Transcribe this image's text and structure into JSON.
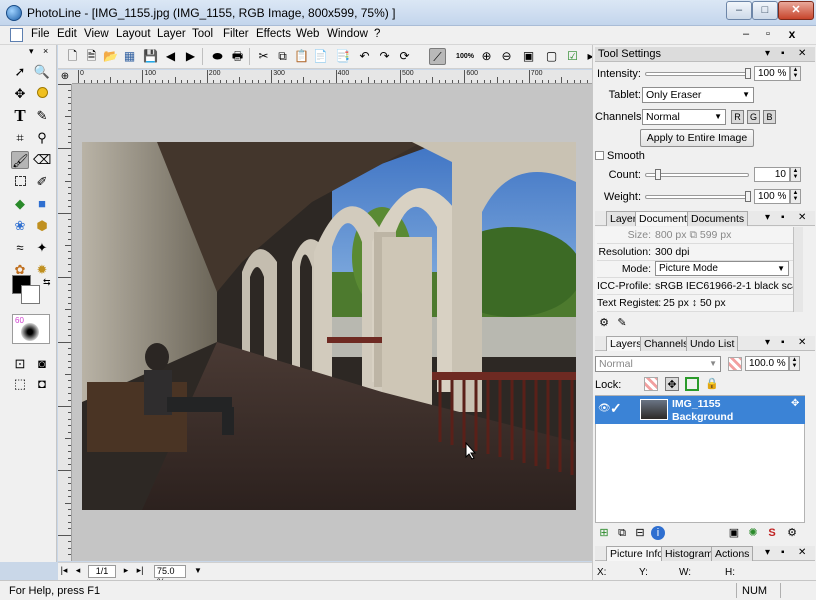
{
  "window": {
    "title": "PhotoLine - [IMG_1155.jpg (IMG_1155, RGB Image, 800x599, 75%) ]",
    "min": "–",
    "max": "□",
    "close": "✕"
  },
  "menu": {
    "items": [
      "File",
      "Edit",
      "View",
      "Layout",
      "Layer",
      "Tool",
      "Filter",
      "Effects",
      "Web",
      "Window",
      "?"
    ],
    "mdi_min": "–",
    "mdi_max": "▫",
    "mdi_close": "x"
  },
  "toolbar": {
    "zoom_100": "100%"
  },
  "ruler": {
    "corner": "⊕",
    "ticks": [
      "0",
      "100",
      "200",
      "300",
      "400",
      "500",
      "600",
      "700",
      "800"
    ]
  },
  "navbar": {
    "page": "1/1",
    "zoom": "75.0 %"
  },
  "status": {
    "help": "For Help, press F1",
    "num": "NUM"
  },
  "tool_settings": {
    "title": "Tool Settings",
    "intensity_label": "Intensity:",
    "intensity_value": "100 %",
    "intensity": 1.0,
    "tablet_label": "Tablet:",
    "tablet_value": "Only Eraser",
    "channels_label": "Channels:",
    "channels_value": "Normal",
    "rgb": [
      "R",
      "G",
      "B"
    ],
    "apply_label": "Apply to Entire Image",
    "smooth_label": "Smooth",
    "count_label": "Count:",
    "count_value": "10",
    "count": 0.1,
    "weight_label": "Weight:",
    "weight_value": "100 %",
    "weight": 1.0
  },
  "doc_panel": {
    "tabs": [
      "Layer",
      "Document",
      "Documents"
    ],
    "rows": [
      {
        "label": "Size:",
        "value": "800 px  ⧉  599 px"
      },
      {
        "label": "Resolution:",
        "value": "300 dpi"
      },
      {
        "label": "Mode:",
        "value": "Picture Mode"
      },
      {
        "label": "ICC-Profile:",
        "value": "sRGB IEC61966-2-1 black scal..."
      },
      {
        "label": "Text Register:",
        "value": "↓ 25 px        ↕ 50 px"
      }
    ]
  },
  "layers_panel": {
    "tabs": [
      "Layers",
      "Channels",
      "Undo List"
    ],
    "blend_mode": "Normal",
    "opacity": "100.0 %",
    "lock_label": "Lock:",
    "layer_name": "IMG_1155",
    "layer_sub": "Background"
  },
  "info_panel": {
    "tabs": [
      "Picture Info",
      "Histogram",
      "Actions"
    ],
    "x_label": "X:",
    "y_label": "Y:",
    "w_label": "W:",
    "h_label": "H:"
  },
  "colors": {
    "selection": "#3b83d6",
    "panel_bg": "#f0f0f0",
    "canvas_bg": "#c5c5c5",
    "close_red": "#c7442b"
  }
}
